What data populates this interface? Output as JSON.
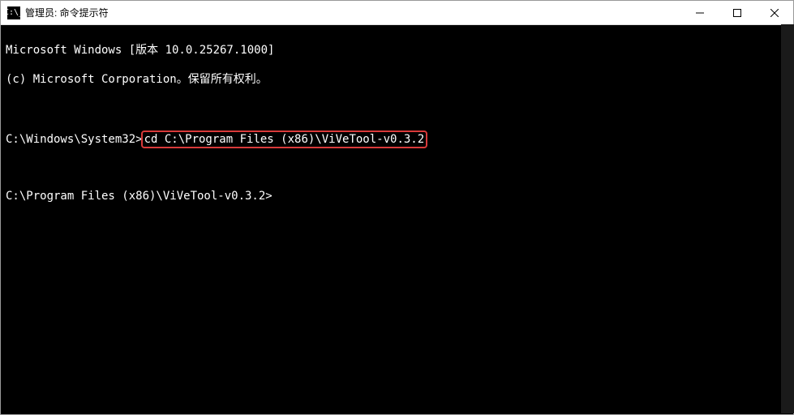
{
  "window": {
    "title": "管理员: 命令提示符",
    "icon_label": "C:\\_"
  },
  "terminal": {
    "line1": "Microsoft Windows [版本 10.0.25267.1000]",
    "line2": "(c) Microsoft Corporation。保留所有权利。",
    "prompt1": "C:\\Windows\\System32>",
    "command1": "cd C:\\Program Files (x86)\\ViVeTool-v0.3.2",
    "prompt2": "C:\\Program Files (x86)\\ViVeTool-v0.3.2>"
  },
  "highlight": {
    "color": "#d93a3a"
  }
}
